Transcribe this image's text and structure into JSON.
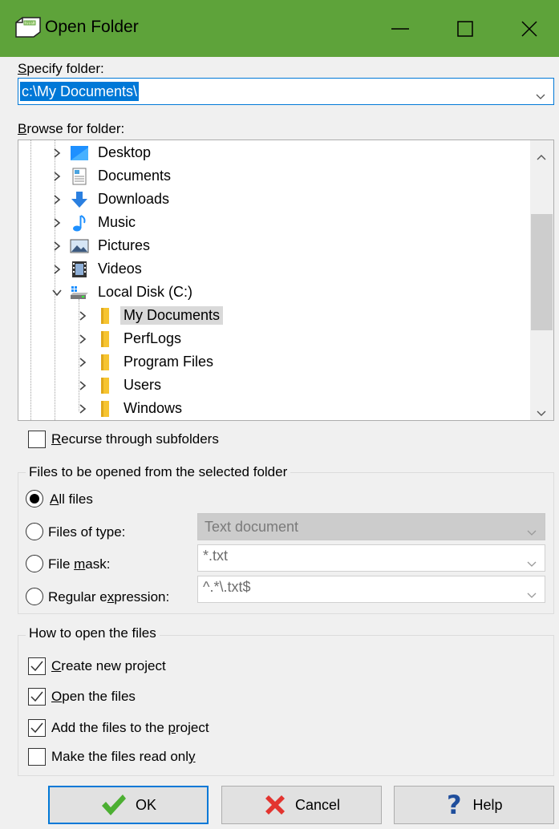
{
  "window": {
    "title": "Open Folder",
    "title_bar_color": "#5ea33a",
    "controls": [
      "minimize-icon",
      "maximize-icon",
      "close-icon"
    ]
  },
  "specify": {
    "label_prefix": "S",
    "label_rest": "pecify folder:",
    "value": "c:\\My Documents\\"
  },
  "browse": {
    "label_prefix": "B",
    "label_rest": "rowse for folder:",
    "items": [
      {
        "label": "Desktop",
        "icon": "desktop-icon",
        "expanded": false
      },
      {
        "label": "Documents",
        "icon": "documents-icon",
        "expanded": false
      },
      {
        "label": "Downloads",
        "icon": "downloads-icon",
        "expanded": false
      },
      {
        "label": "Music",
        "icon": "music-icon",
        "expanded": false
      },
      {
        "label": "Pictures",
        "icon": "pictures-icon",
        "expanded": false
      },
      {
        "label": "Videos",
        "icon": "videos-icon",
        "expanded": false
      },
      {
        "label": "Local Disk (C:)",
        "icon": "drive-icon",
        "expanded": true
      },
      {
        "label": "My Documents",
        "icon": "folder-icon",
        "selected": true
      },
      {
        "label": "PerfLogs",
        "icon": "folder-icon"
      },
      {
        "label": "Program Files",
        "icon": "folder-icon"
      },
      {
        "label": "Users",
        "icon": "folder-icon"
      },
      {
        "label": "Windows",
        "icon": "folder-icon"
      }
    ]
  },
  "recurse": {
    "label_prefix": "R",
    "label_rest": "ecurse through subfolders",
    "checked": false
  },
  "files_group": {
    "title": "Files to be opened from the selected folder",
    "all_files": {
      "prefix": "A",
      "rest": "ll files",
      "selected": true
    },
    "files_of_type": {
      "label": "Files of type:",
      "value": "Text document",
      "selected": false
    },
    "file_mask": {
      "before": "File ",
      "underlined": "m",
      "after": "ask:",
      "value": "*.txt",
      "selected": false
    },
    "regex": {
      "before": "Regular e",
      "underlined": "x",
      "after": "pression:",
      "value": "^.*\\.txt$",
      "selected": false
    }
  },
  "how_group": {
    "title": "How to open the files",
    "create_project": {
      "prefix": "C",
      "rest": "reate new project",
      "checked": true
    },
    "open_files": {
      "prefix": "O",
      "rest": "pen the files",
      "checked": true
    },
    "add_files": {
      "before": "Add the files to the ",
      "underlined": "p",
      "after": "roject",
      "checked": true
    },
    "read_only": {
      "before": "Make the files read onl",
      "underlined": "y",
      "after": "",
      "checked": false
    }
  },
  "buttons": {
    "ok": "OK",
    "cancel": "Cancel",
    "help": "Help"
  },
  "colors": {
    "accent": "#0078d7",
    "ok_check": "#4caf32",
    "cancel_x": "#e3342f",
    "help_q": "#1f4e9c",
    "folder": "#f6c431"
  }
}
